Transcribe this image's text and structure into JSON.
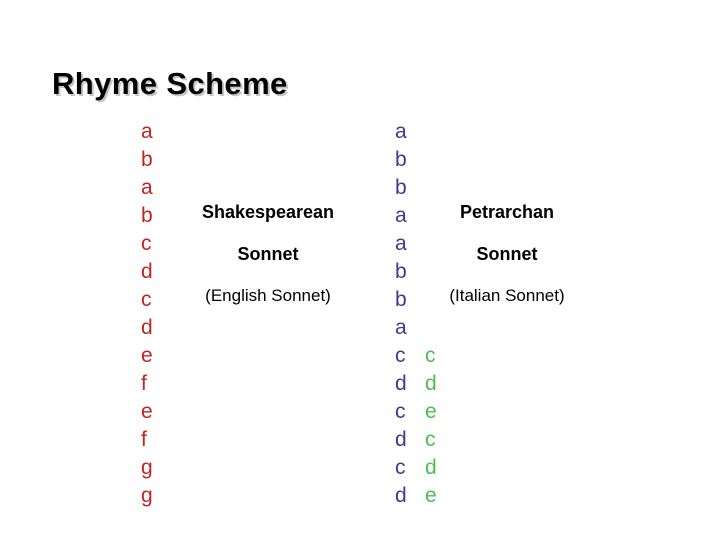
{
  "slide": {
    "title": "Rhyme Scheme",
    "background_color": "#ffffff"
  },
  "colors": {
    "title": "#000000",
    "shakespearean_letters": "#C3241F",
    "petrarchan_octave_letters": "#3B3B96",
    "petrarchan_sestet_letters": "#4CC04C",
    "label_text": "#000000"
  },
  "shakespearean": {
    "name": "Shakespearean",
    "kind": "Sonnet",
    "alt_name": "(English Sonnet)",
    "rhyme_letters": [
      "a",
      "b",
      "a",
      "b",
      "c",
      "d",
      "c",
      "d",
      "e",
      "f",
      "e",
      "f",
      "g",
      "g"
    ]
  },
  "petrarchan": {
    "name": "Petrarchan",
    "kind": "Sonnet",
    "alt_name": "(Italian Sonnet)",
    "rhyme_letters": [
      "a",
      "b",
      "b",
      "a",
      "a",
      "b",
      "b",
      "a",
      "c",
      "d",
      "c",
      "d",
      "c",
      "d"
    ],
    "sestet_letters": [
      "",
      "",
      "",
      "",
      "",
      "",
      "",
      "",
      "c",
      "d",
      "e",
      "c",
      "d",
      "e"
    ]
  }
}
